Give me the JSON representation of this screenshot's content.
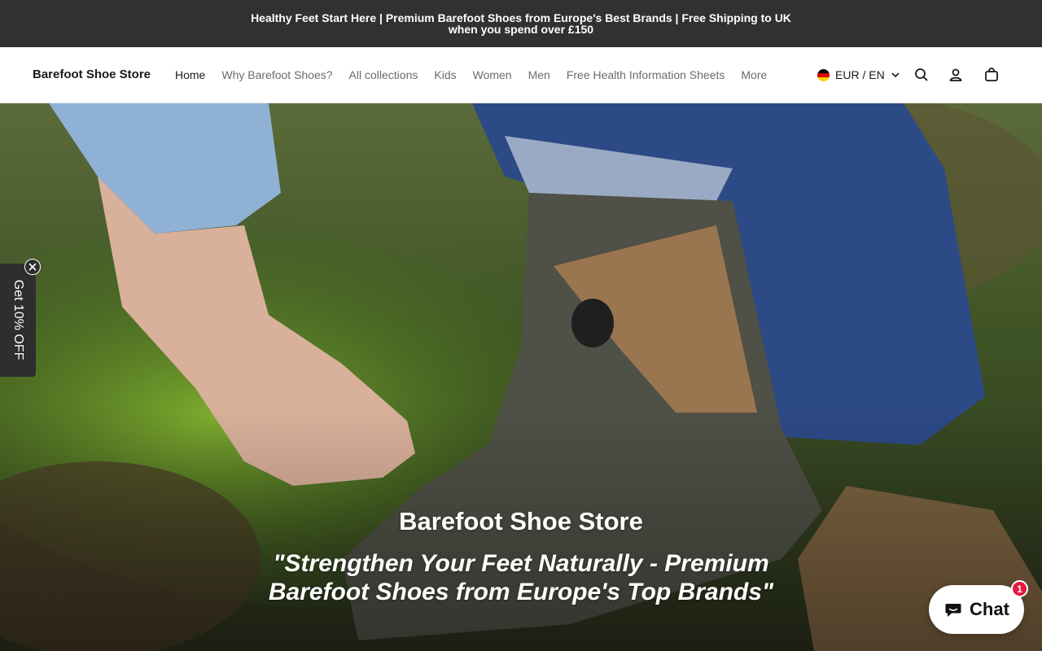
{
  "announcement": {
    "text": "Healthy Feet Start Here | Premium Barefoot Shoes from Europe's Best Brands | Free Shipping to UK when you spend over £150"
  },
  "header": {
    "logo": "Barefoot Shoe Store",
    "nav": [
      {
        "label": "Home",
        "active": true
      },
      {
        "label": "Why Barefoot Shoes?"
      },
      {
        "label": "All collections"
      },
      {
        "label": "Kids"
      },
      {
        "label": "Women"
      },
      {
        "label": "Men"
      },
      {
        "label": "Free Health Information Sheets"
      },
      {
        "label": "More"
      }
    ],
    "locale": {
      "label": "EUR / EN",
      "flag": "germany-flag"
    },
    "icons": [
      "search-icon",
      "account-icon",
      "cart-icon"
    ]
  },
  "hero": {
    "title": "Barefoot Shoe Store",
    "tagline": "\"Strengthen Your Feet Naturally - Premium Barefoot Shoes from Europe's Top Brands\""
  },
  "discount_tab": {
    "label": "Get 10% OFF"
  },
  "chat_widget": {
    "label": "Chat",
    "badge": "1"
  },
  "colors": {
    "announcement_bg": "#313131",
    "header_bg": "#ffffff",
    "nav_text": "#6b6b6b",
    "discount_bg": "#2e2e2e",
    "chat_badge": "#e5173f"
  }
}
